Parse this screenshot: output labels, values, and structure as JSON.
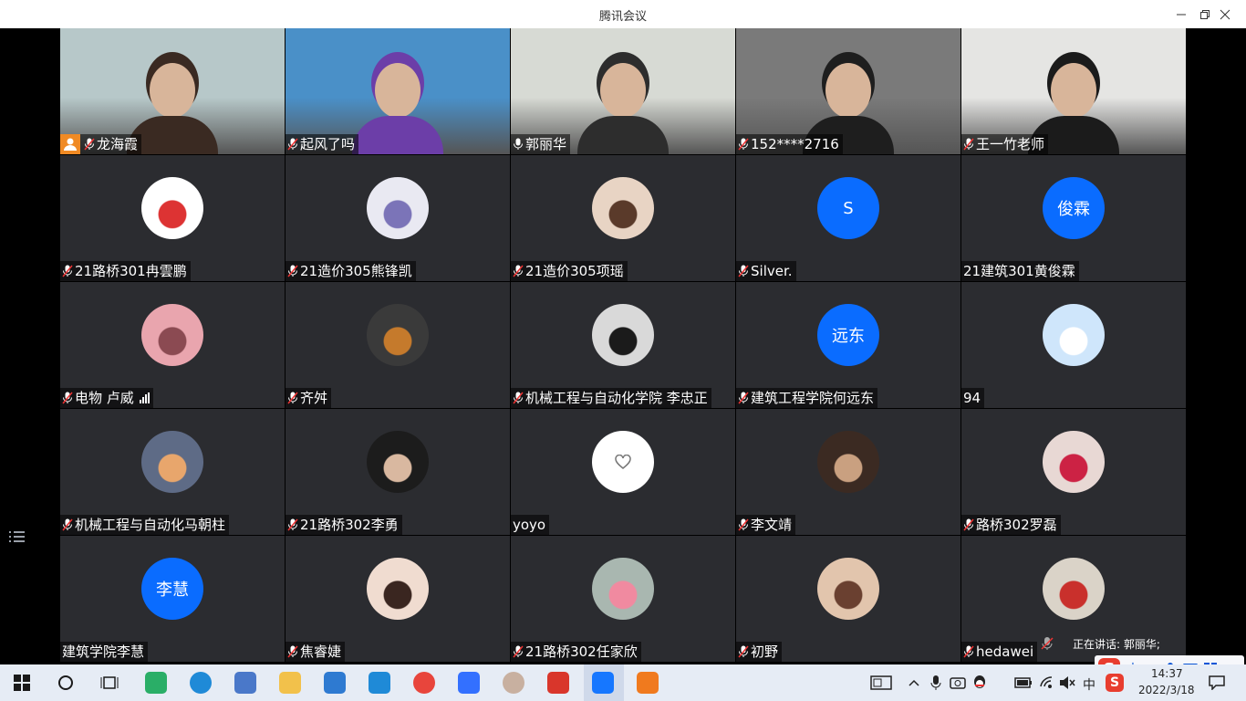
{
  "window": {
    "title": "腾讯会议"
  },
  "participants": [
    {
      "name": "龙海霞",
      "mic": true,
      "host": true,
      "video": true,
      "photo": "woman-glasses-curtain"
    },
    {
      "name": "起风了吗",
      "mic": true,
      "video": true,
      "photo": "boy-purple-shirt"
    },
    {
      "name": "郭丽华",
      "mic": "active",
      "video": true,
      "speaking": true,
      "photo": "woman-classroom"
    },
    {
      "name": "152****2716",
      "mic": true,
      "video": true,
      "photo": "woman-partial"
    },
    {
      "name": "王一竹老师",
      "mic": true,
      "video": true,
      "photo": "woman-long-hair"
    },
    {
      "name": "21路桥301冉雲鹏",
      "mic": true,
      "avatar_icon": "bugs-bunny-avatar"
    },
    {
      "name": "21造价305熊锋凯",
      "mic": true,
      "avatar_icon": "cartoon-bird-avatar"
    },
    {
      "name": "21造价305项瑶",
      "mic": true,
      "avatar_icon": "anime-girl-avatar"
    },
    {
      "name": "Silver.",
      "mic": true,
      "avatar_text": "S"
    },
    {
      "name": "21建筑301黄俊霖",
      "mic": false,
      "avatar_text": "俊霖"
    },
    {
      "name": "电物 卢威",
      "mic": true,
      "signal": true,
      "avatar_icon": "pink-hair-avatar"
    },
    {
      "name": "齐舛",
      "mic": true,
      "avatar_icon": "lion-character-avatar"
    },
    {
      "name": "机械工程与自动化学院 李忠正",
      "mic": true,
      "avatar_icon": "anime-boy-avatar"
    },
    {
      "name": "建筑工程学院何远东",
      "mic": true,
      "avatar_text": "远东"
    },
    {
      "name": "94",
      "mic": false,
      "avatar_icon": "cartoon-dog-avatar"
    },
    {
      "name": "机械工程与自动化马朝柱",
      "mic": true,
      "avatar_icon": "sunset-avatar"
    },
    {
      "name": "21路桥302李勇",
      "mic": true,
      "avatar_icon": "young-man-avatar"
    },
    {
      "name": "yoyo",
      "mic": false,
      "avatar_icon": "heart-avatar"
    },
    {
      "name": "李文靖",
      "mic": true,
      "avatar_icon": "smiling-person-avatar"
    },
    {
      "name": "路桥302罗磊",
      "mic": true,
      "avatar_icon": "doll-avatar"
    },
    {
      "name": "建筑学院李慧",
      "mic": false,
      "avatar_text": "李慧"
    },
    {
      "name": "焦睿婕",
      "mic": true,
      "avatar_icon": "girl-selfie-avatar"
    },
    {
      "name": "21路桥302任家欣",
      "mic": true,
      "avatar_icon": "patrick-star-avatar"
    },
    {
      "name": "初野",
      "mic": true,
      "avatar_icon": "girl-portrait-avatar"
    },
    {
      "name": "hedawei",
      "mic": true,
      "avatar_icon": "woman-photo-avatar"
    }
  ],
  "speaking_indicator": {
    "text": "正在讲话: 郭丽华;"
  },
  "ime": {
    "lang": "中",
    "punct": "•,"
  },
  "taskbar": {
    "time": "14:37",
    "date": "2022/3/18",
    "ime_lang": "中",
    "apps": [
      "wechat-icon",
      "edge-icon",
      "store-icon",
      "file-explorer-icon",
      "mail-icon",
      "ie-icon",
      "chrome-icon",
      "feishu-icon",
      "avatar-app-icon",
      "wps-icon",
      "tencent-meeting-icon",
      "media-player-icon"
    ]
  },
  "colors": {
    "accent": "#0a6cff",
    "speaking": "#2ea84f",
    "host": "#f08a24",
    "tile": "#2b2c30"
  }
}
